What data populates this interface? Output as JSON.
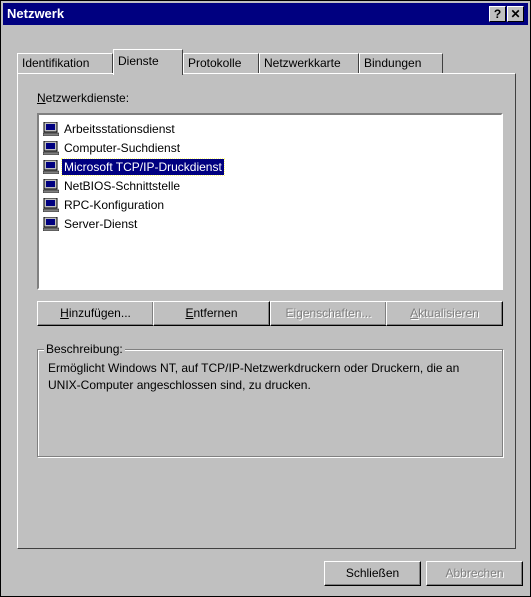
{
  "window": {
    "title": "Netzwerk",
    "help_btn": "?",
    "close_btn": "✕"
  },
  "tabs": [
    {
      "label": "Identifikation",
      "active": false
    },
    {
      "label": "Dienste",
      "active": true
    },
    {
      "label": "Protokolle",
      "active": false
    },
    {
      "label": "Netzwerkkarte",
      "active": false
    },
    {
      "label": "Bindungen",
      "active": false
    }
  ],
  "services_label": {
    "mnemonic": "N",
    "rest": "etzwerkdienste:"
  },
  "services": [
    {
      "label": "Arbeitsstationsdienst",
      "selected": false
    },
    {
      "label": "Computer-Suchdienst",
      "selected": false
    },
    {
      "label": "Microsoft TCP/IP-Druckdienst",
      "selected": true
    },
    {
      "label": "NetBIOS-Schnittstelle",
      "selected": false
    },
    {
      "label": "RPC-Konfiguration",
      "selected": false
    },
    {
      "label": "Server-Dienst",
      "selected": false
    }
  ],
  "buttons": {
    "add": {
      "mnemonic": "H",
      "rest": "inzufügen..."
    },
    "remove": {
      "mnemonic": "E",
      "rest": "ntfernen"
    },
    "properties": {
      "pre": "Ei",
      "mnemonic": "g",
      "rest": "enschaften..."
    },
    "update": {
      "mnemonic": "A",
      "rest": "ktualisieren"
    }
  },
  "description": {
    "title": "Beschreibung:",
    "text": "Ermöglicht Windows NT, auf TCP/IP-Netzwerkdruckern oder Druckern, die an UNIX-Computer angeschlossen sind, zu drucken."
  },
  "footer": {
    "close": "Schließen",
    "cancel": "Abbrechen"
  }
}
